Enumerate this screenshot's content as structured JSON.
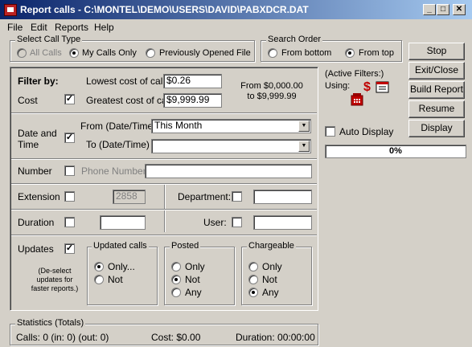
{
  "window": {
    "title": "Report calls - C:\\MONTEL\\DEMO\\USERS\\DAVID\\PABXDCR.DAT"
  },
  "caption_buttons": {
    "minimize": "_",
    "maximize": "□",
    "close": "✕"
  },
  "menu": [
    "File",
    "Edit",
    "Reports",
    "Help"
  ],
  "call_type": {
    "title": "Select Call Type",
    "options": [
      "All Calls",
      "My Calls Only",
      "Previously Opened File"
    ],
    "selected": "My Calls Only"
  },
  "search_order": {
    "title": "Search Order",
    "options": [
      "From bottom",
      "From top"
    ],
    "selected": "From top"
  },
  "buttons": [
    "Stop",
    "Exit/Close",
    "Build Report",
    "Resume",
    "Display"
  ],
  "active_filters": {
    "label": "(Active Filters:)",
    "using_label": "Using:"
  },
  "auto_display": {
    "label": "Auto Display",
    "checked": false
  },
  "progress": {
    "text": "0%",
    "value": 0
  },
  "filter": {
    "heading": "Filter by:",
    "cost": {
      "label": "Cost",
      "checked": true,
      "lowest_label": "Lowest cost of call",
      "lowest_value": "$0.26",
      "greatest_label": "Greatest cost of call",
      "greatest_value": "$9,999.99",
      "range_line1": "From $0,000.00",
      "range_line2": "to $9,999.99"
    },
    "date_time": {
      "label_line1": "Date and",
      "label_line2": "Time",
      "checked": true,
      "from_label": "From (Date/Time)",
      "from_value": "This Month",
      "to_label": "To (Date/Time)",
      "to_value": ""
    },
    "number": {
      "label": "Number",
      "checked": false,
      "field_label": "Phone Number",
      "value": ""
    },
    "extension": {
      "label": "Extension",
      "checked": false,
      "value": "2858"
    },
    "department": {
      "label": "Department:",
      "checked": false,
      "value": ""
    },
    "duration": {
      "label": "Duration",
      "checked": false,
      "value": ""
    },
    "user": {
      "label": "User:",
      "checked": false,
      "value": ""
    },
    "updates": {
      "label": "Updates",
      "checked": true,
      "note_line1": "(De-select",
      "note_line2": "updates for",
      "note_line3": "faster reports.)"
    },
    "updated_calls": {
      "title": "Updated calls",
      "options": [
        "Only...",
        "Not"
      ],
      "selected": "Only..."
    },
    "posted": {
      "title": "Posted",
      "options": [
        "Only",
        "Not",
        "Any"
      ],
      "selected": "Not"
    },
    "chargeable": {
      "title": "Chargeable",
      "options": [
        "Only",
        "Not",
        "Any"
      ],
      "selected": "Any"
    }
  },
  "statistics": {
    "title": "Statistics (Totals)",
    "calls": "Calls: 0  (in: 0)  (out: 0)",
    "cost": "Cost: $0.00",
    "duration": "Duration: 00:00:00"
  }
}
